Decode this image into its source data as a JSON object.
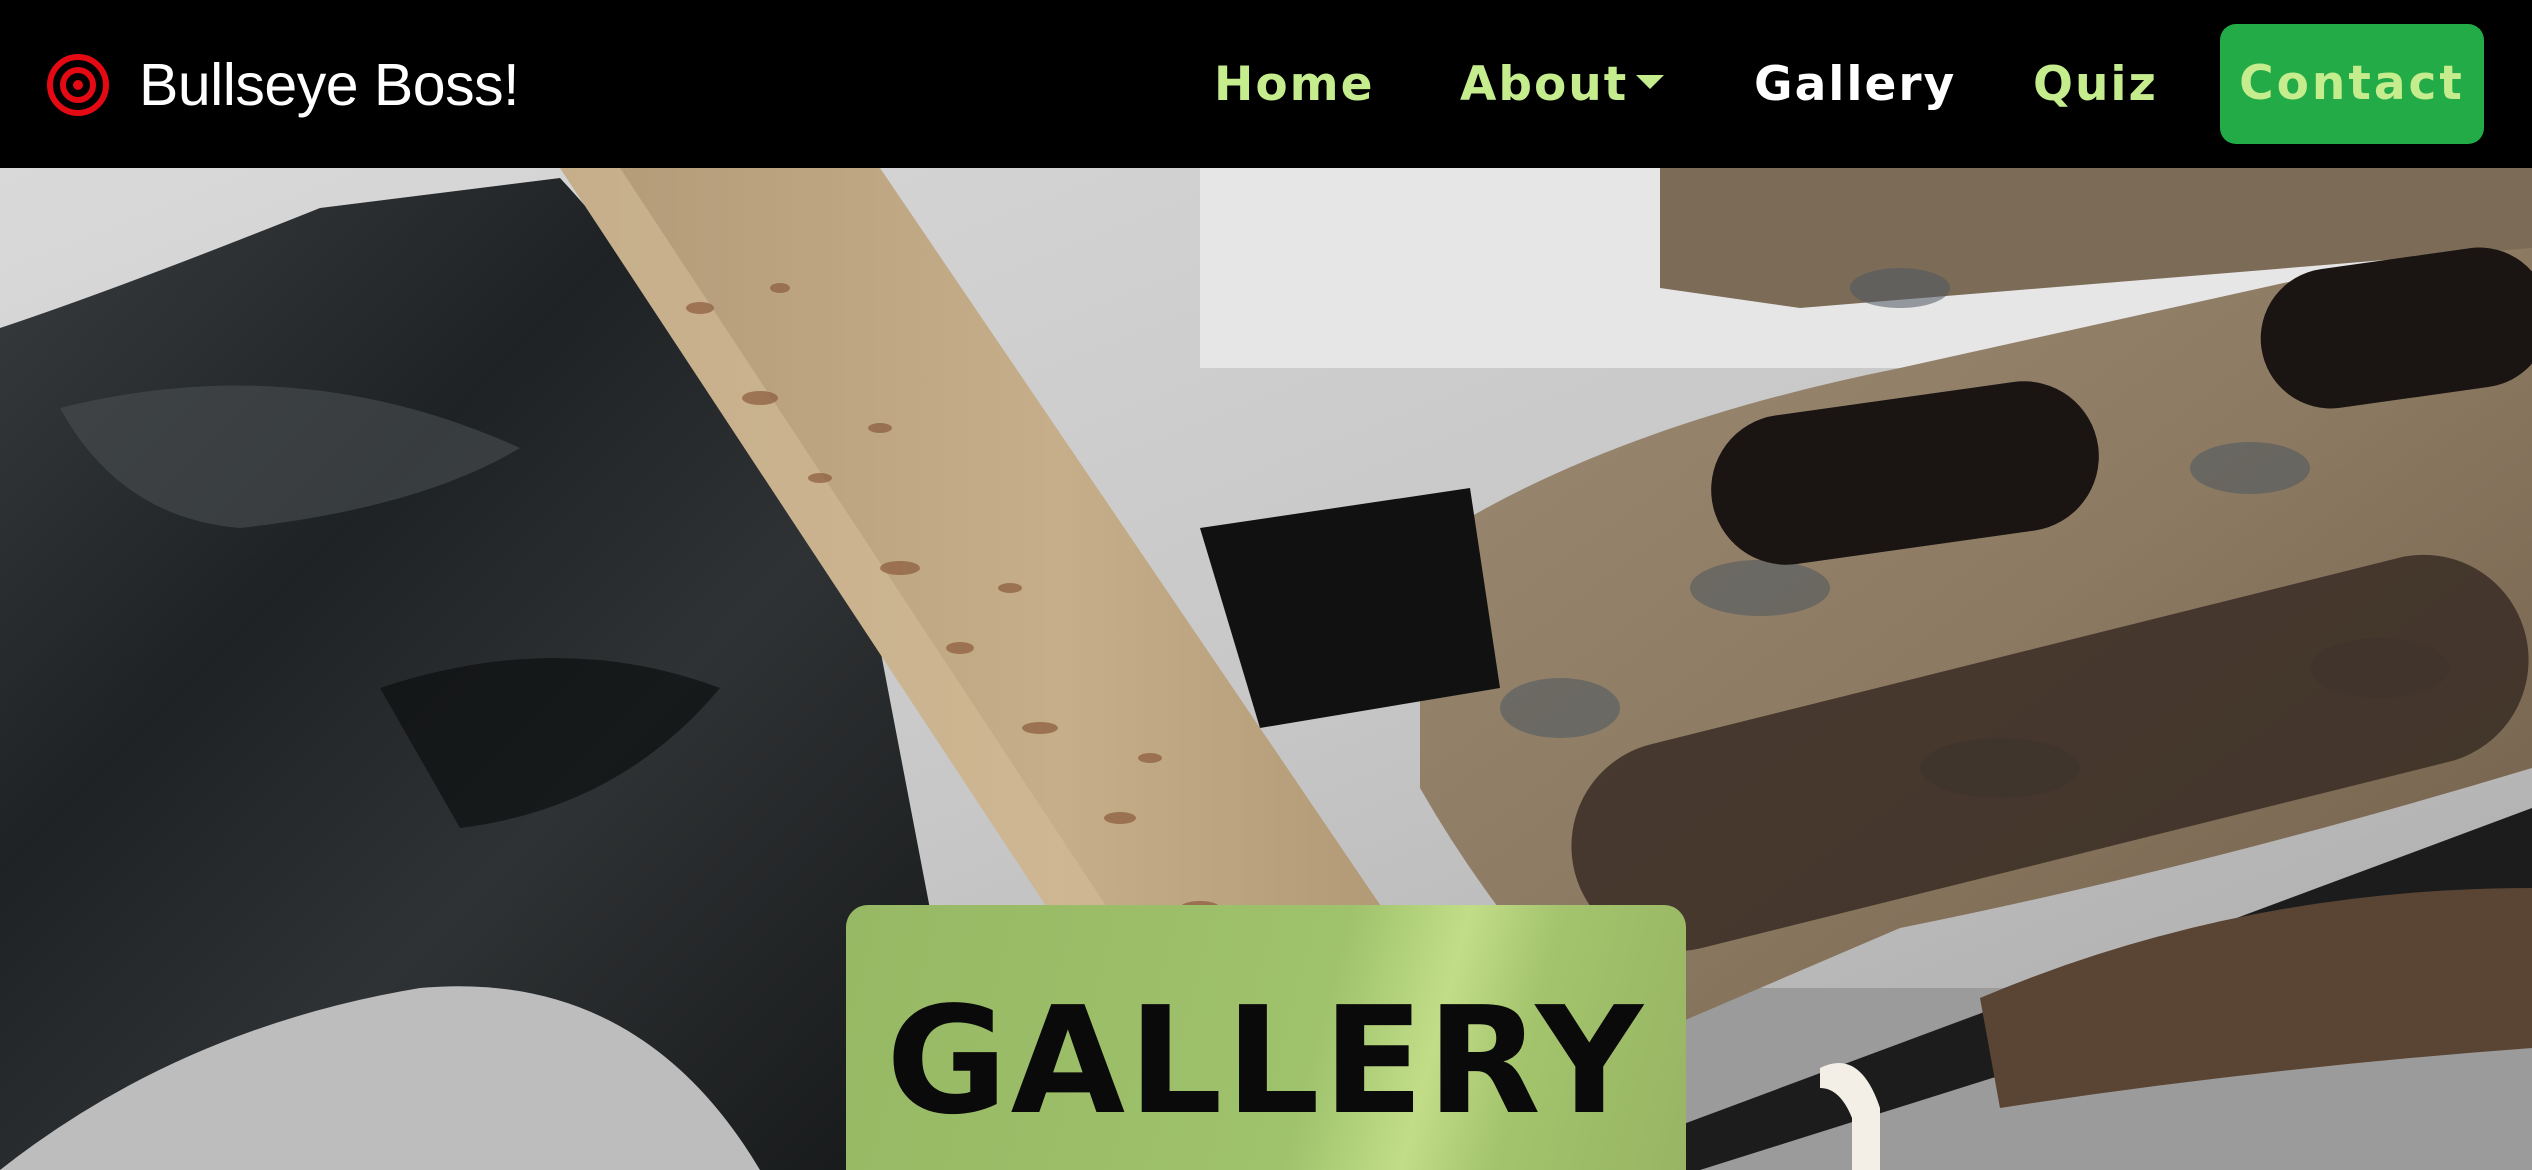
{
  "brand": {
    "name": "Bullseye Boss!",
    "icon": "target-icon",
    "icon_color": "#e50914"
  },
  "nav": {
    "items": [
      {
        "label": "Home",
        "active": false
      },
      {
        "label": "About",
        "active": false,
        "dropdown": true
      },
      {
        "label": "Gallery",
        "active": true
      },
      {
        "label": "Quiz",
        "active": false
      }
    ],
    "contact_label": "Contact",
    "link_color": "#c5ec8d",
    "active_color": "#ffffff",
    "contact_bg": "#22ab46"
  },
  "hero": {
    "image": "crossbow-closeup-photo",
    "title": "GALLERY",
    "title_box_color": "#9fc26c"
  }
}
